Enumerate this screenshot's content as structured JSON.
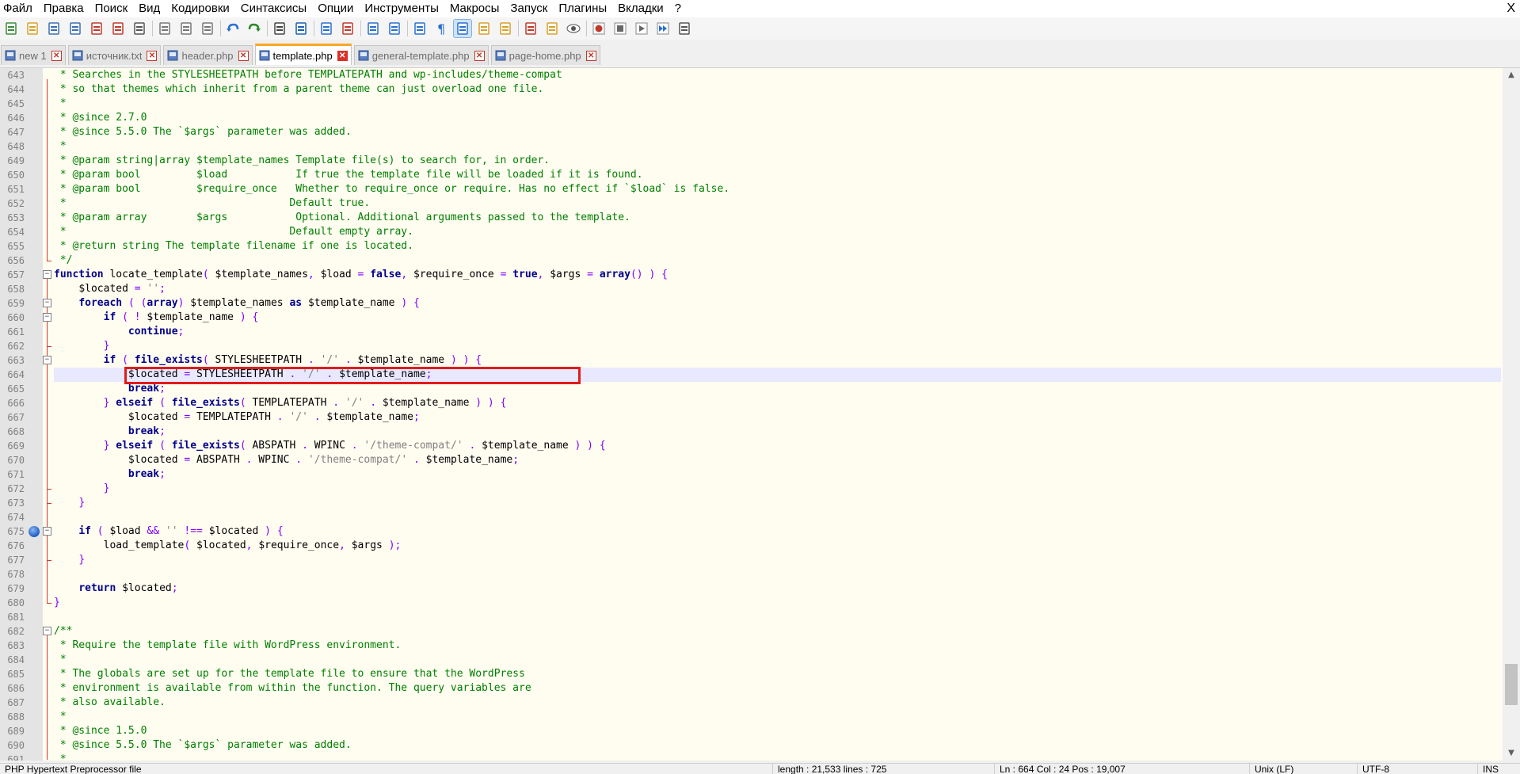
{
  "menu": {
    "items": [
      "Файл",
      "Правка",
      "Поиск",
      "Вид",
      "Кодировки",
      "Синтаксисы",
      "Опции",
      "Инструменты",
      "Макросы",
      "Запуск",
      "Плагины",
      "Вкладки",
      "?"
    ],
    "close_label": "X"
  },
  "toolbar": {
    "buttons": [
      {
        "icon": "new-file-icon"
      },
      {
        "icon": "open-file-icon"
      },
      {
        "icon": "save-icon"
      },
      {
        "icon": "save-all-icon"
      },
      {
        "icon": "close-icon"
      },
      {
        "icon": "close-all-icon"
      },
      {
        "icon": "print-icon"
      },
      {
        "icon": "cut-icon"
      },
      {
        "icon": "copy-icon"
      },
      {
        "icon": "paste-icon"
      },
      {
        "icon": "undo-icon"
      },
      {
        "icon": "redo-icon"
      },
      {
        "icon": "find-icon"
      },
      {
        "icon": "replace-icon"
      },
      {
        "icon": "zoom-in-icon"
      },
      {
        "icon": "zoom-out-icon"
      },
      {
        "icon": "sync-vertical-icon"
      },
      {
        "icon": "sync-horizontal-icon"
      },
      {
        "icon": "word-wrap-icon"
      },
      {
        "icon": "show-all-chars-icon"
      },
      {
        "icon": "indent-guide-icon"
      },
      {
        "icon": "user-language-icon"
      },
      {
        "icon": "document-map-icon"
      },
      {
        "icon": "function-list-icon"
      },
      {
        "icon": "folder-workspace-icon"
      },
      {
        "icon": "monitoring-icon"
      },
      {
        "icon": "record-macro-icon"
      },
      {
        "icon": "stop-macro-icon"
      },
      {
        "icon": "play-macro-icon"
      },
      {
        "icon": "run-macro-multiple-icon"
      },
      {
        "icon": "save-macro-icon"
      }
    ]
  },
  "tabs": [
    {
      "label": "new 1",
      "active": false
    },
    {
      "label": "источник.txt",
      "active": false
    },
    {
      "label": "header.php",
      "active": false
    },
    {
      "label": "template.php",
      "active": true
    },
    {
      "label": "general-template.php",
      "active": false
    },
    {
      "label": "page-home.php",
      "active": false
    }
  ],
  "editor": {
    "line_numbers": [
      "643",
      "644",
      "645",
      "646",
      "647",
      "648",
      "649",
      "650",
      "651",
      "652",
      "653",
      "654",
      "655",
      "656",
      "657",
      "658",
      "659",
      "660",
      "661",
      "662",
      "663",
      "664",
      "665",
      "666",
      "667",
      "668",
      "669",
      "670",
      "671",
      "672",
      "673",
      "674",
      "675",
      "676",
      "677",
      "678",
      "679",
      "680",
      "681",
      "682",
      "683",
      "684",
      "685",
      "686",
      "687",
      "688",
      "689",
      "690",
      "691"
    ],
    "current_line": "664",
    "bookmark_line": "675",
    "lines": [
      " * Searches in the STYLESHEETPATH before TEMPLATEPATH and wp-includes/theme-compat",
      " * so that themes which inherit from a parent theme can just overload one file.",
      " *",
      " * @since 2.7.0",
      " * @since 5.5.0 The `$args` parameter was added.",
      " *",
      " * @param string|array $template_names Template file(s) to search for, in order.",
      " * @param bool         $load           If true the template file will be loaded if it is found.",
      " * @param bool         $require_once   Whether to require_once or require. Has no effect if `$load` is false.",
      " *                                    Default true.",
      " * @param array        $args           Optional. Additional arguments passed to the template.",
      " *                                    Default empty array.",
      " * @return string The template filename if one is located.",
      " */",
      "function locate_template( $template_names, $load = false, $require_once = true, $args = array() ) {",
      "    $located = '';",
      "    foreach ( (array) $template_names as $template_name ) {",
      "        if ( ! $template_name ) {",
      "            continue;",
      "        }",
      "        if ( file_exists( STYLESHEETPATH . '/' . $template_name ) ) {",
      "            $located = STYLESHEETPATH . '/' . $template_name;",
      "            break;",
      "        } elseif ( file_exists( TEMPLATEPATH . '/' . $template_name ) ) {",
      "            $located = TEMPLATEPATH . '/' . $template_name;",
      "            break;",
      "        } elseif ( file_exists( ABSPATH . WPINC . '/theme-compat/' . $template_name ) ) {",
      "            $located = ABSPATH . WPINC . '/theme-compat/' . $template_name;",
      "            break;",
      "        }",
      "    }",
      "",
      "    if ( $load && '' !== $located ) {",
      "        load_template( $located, $require_once, $args );",
      "    }",
      "",
      "    return $located;",
      "}",
      "",
      "/**",
      " * Require the template file with WordPress environment.",
      " *",
      " * The globals are set up for the template file to ensure that the WordPress",
      " * environment is available from within the function. The query variables are",
      " * also available.",
      " *",
      " * @since 1.5.0",
      " * @since 5.5.0 The `$args` parameter was added.",
      " *"
    ]
  },
  "statusbar": {
    "file_type": "PHP Hypertext Preprocessor file",
    "length_lines": "length : 21,533    lines : 725",
    "position": "Ln : 664    Col : 24    Pos : 19,007",
    "eol": "Unix (LF)",
    "encoding": "UTF-8",
    "mode": "INS"
  }
}
